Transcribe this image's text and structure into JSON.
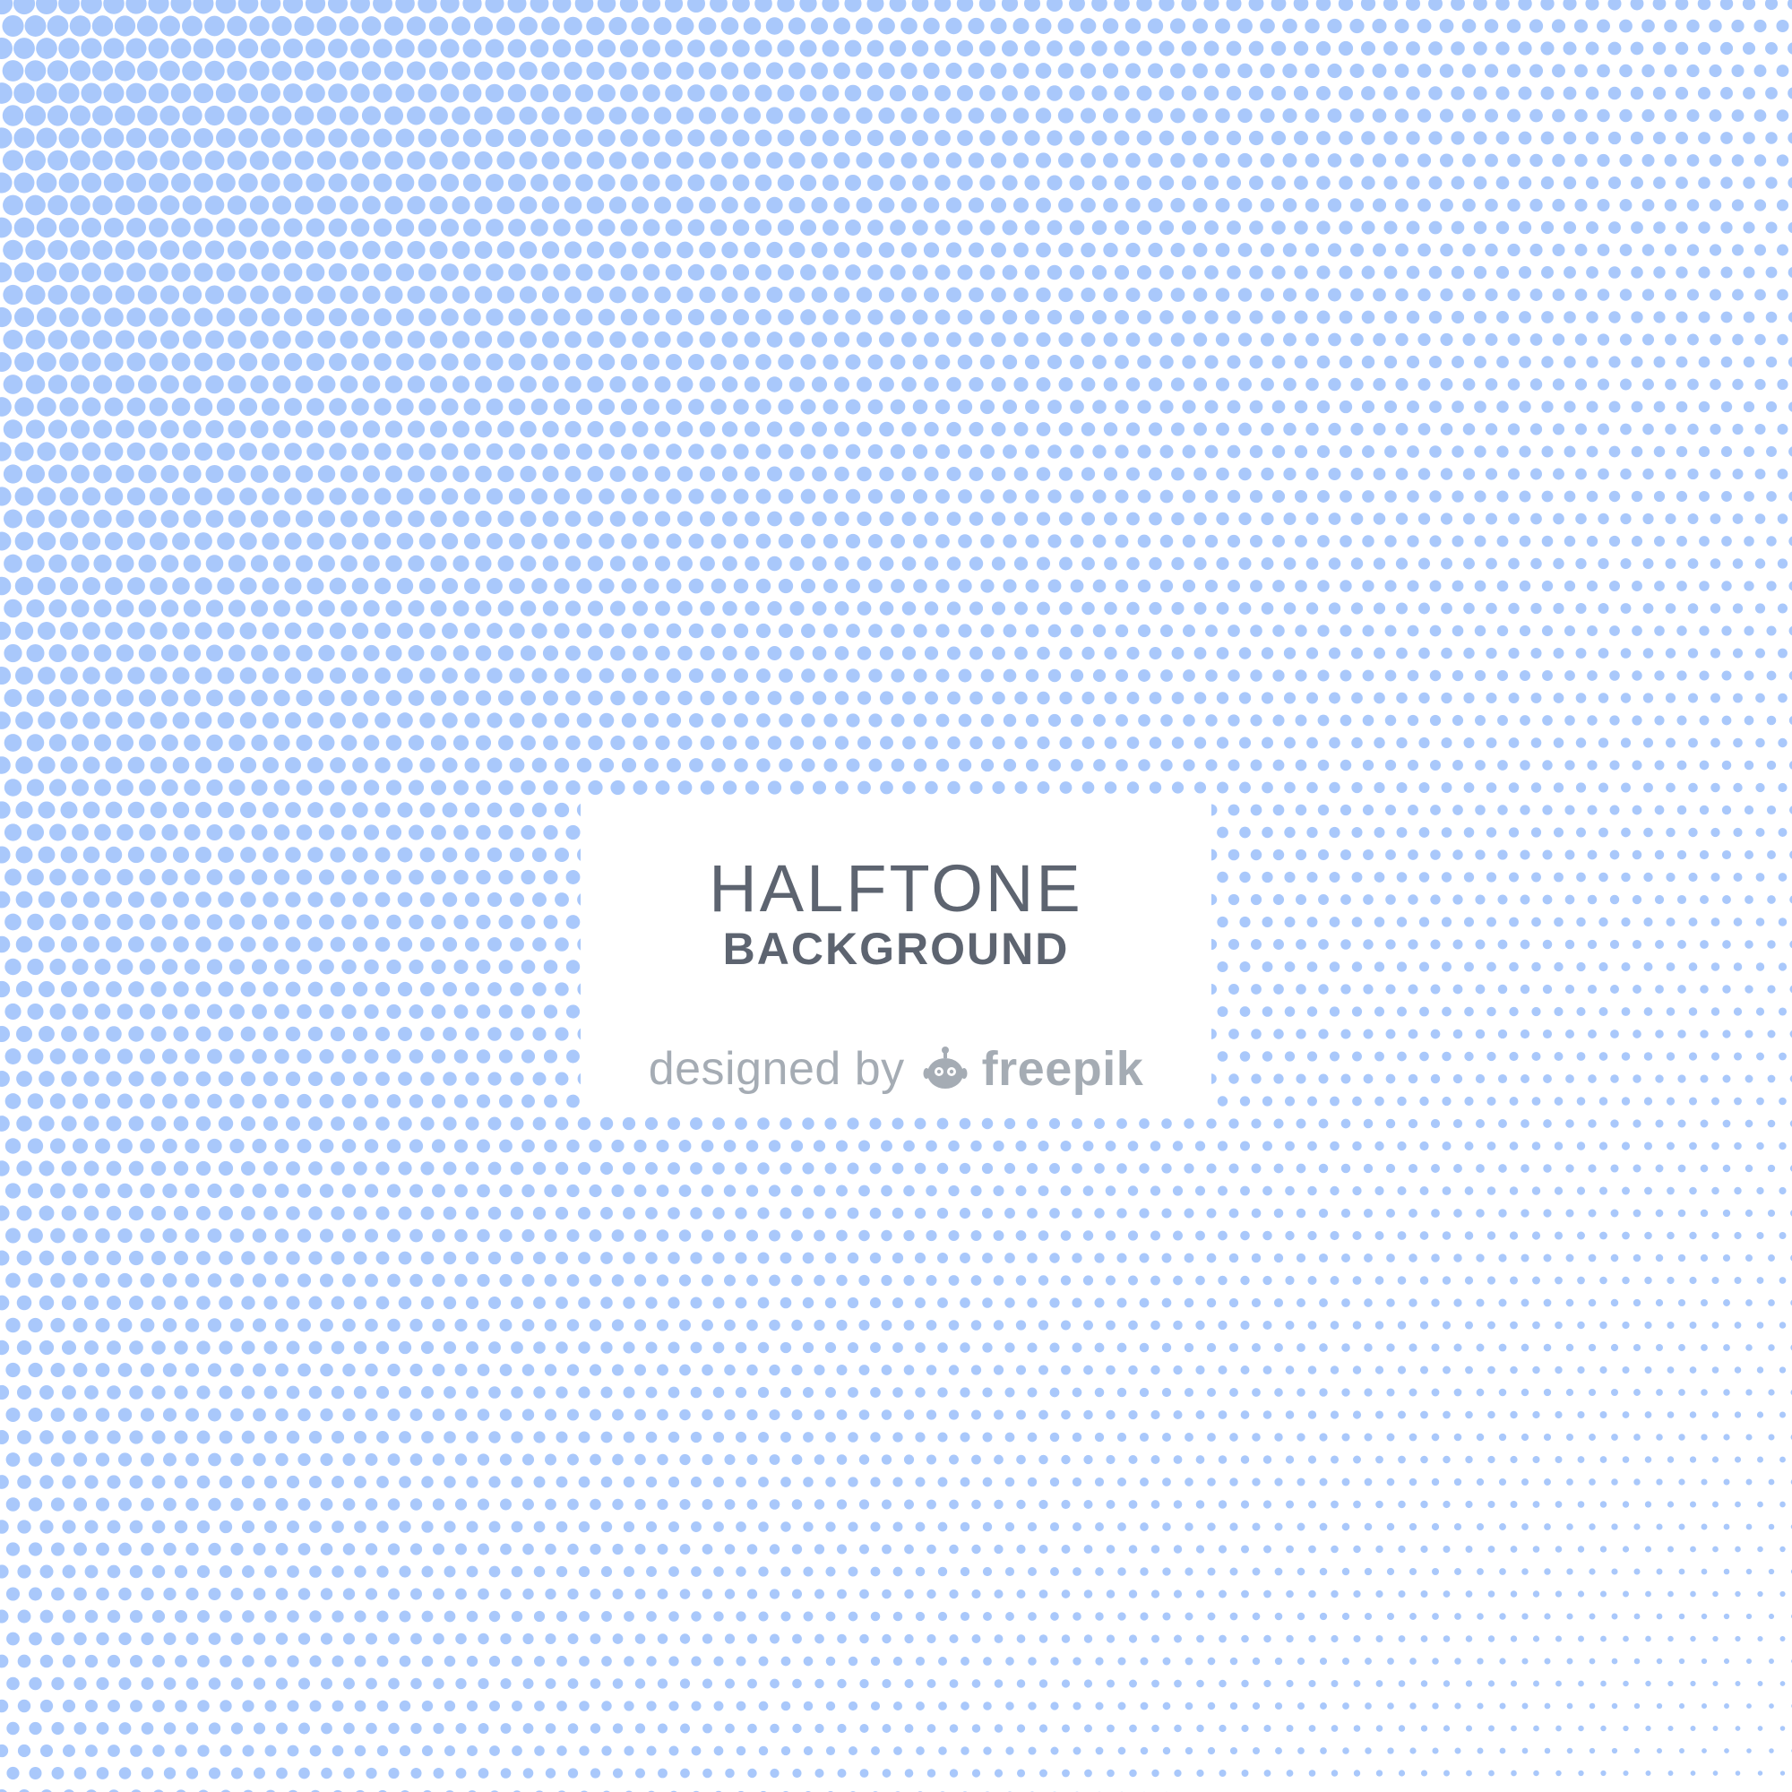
{
  "title": {
    "line1": "HALFTONE",
    "line2": "BACKGROUND"
  },
  "credit": {
    "prefix": "designed by",
    "logo_icon": "freepik-mascot-icon",
    "brand": "freepik"
  },
  "colors": {
    "background": "#ffffff",
    "dots": "#a9c8fb",
    "title_text": "#5d6470",
    "credit_text": "#a5acb4"
  },
  "pattern": {
    "style": "halftone dots",
    "gradient": "large dots at top-left fading to tiny dots at bottom-right"
  }
}
